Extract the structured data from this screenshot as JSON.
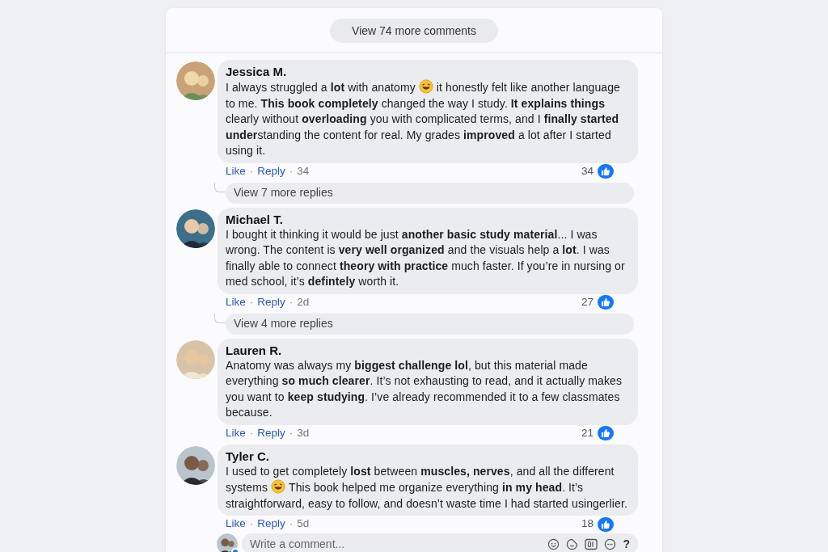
{
  "header": {
    "view_more": "View 74 more comments"
  },
  "comments": [
    {
      "author": "Jessica M.",
      "body": [
        "I always struggled a **lot** with anatomy",
        "it honestly felt like another language to me. **This book completely** changed the way I study. **It explains** **things** clearly without **overloading** you with complicated terms, and I **finally started under**standing the content for real. My grades **improved** a lot after I started using it."
      ],
      "like": "Like",
      "separators": [
        "·",
        "·"
      ],
      "reply": "Reply",
      "time": "34",
      "reactions": "34",
      "more_replies": "View 7 more replies"
    },
    {
      "author": "Michael T.",
      "body": [
        "I bought it thinking it would be just **another basic study material**... I was wrong. The content is **very well organized** and the visuals help a **lot**. I was finally able to connect **theory with practice** much faster. If you’re in nursing or med school, it’s **defintely** worth it."
      ],
      "like": "Like",
      "separators": [
        "·",
        "·"
      ],
      "reply": "Reply",
      "time": "2d",
      "reactions": "27",
      "more_replies": "View 4 more replies"
    },
    {
      "author": "Lauren R.",
      "body": [
        "Anatomy was always my **biggest challenge lol**, but this material made everything **so much clearer**. It’s not exhausting to read, and it actually makes you want to **keep studying**. I’ve already recommended it to a few classmates because."
      ],
      "like": "Like",
      "separators": [
        "·",
        "·"
      ],
      "reply": "Reply",
      "time": "3d",
      "reactions": "21"
    },
    {
      "author": "Tyler C.",
      "body": [
        "I used to get completely **lost** between **muscles, nerves**, and all the different systems",
        "This book helped me organize everything **in my head**. It’s straightforward, easy to follow, and doesn’t waste time I had started usingerlier."
      ],
      "like": "Like",
      "separators": [
        "·",
        "·"
      ],
      "reply": "Reply",
      "time": "5d",
      "reactions": "18"
    }
  ],
  "composer": {
    "placeholder": "Write a comment...",
    "help": "?"
  }
}
